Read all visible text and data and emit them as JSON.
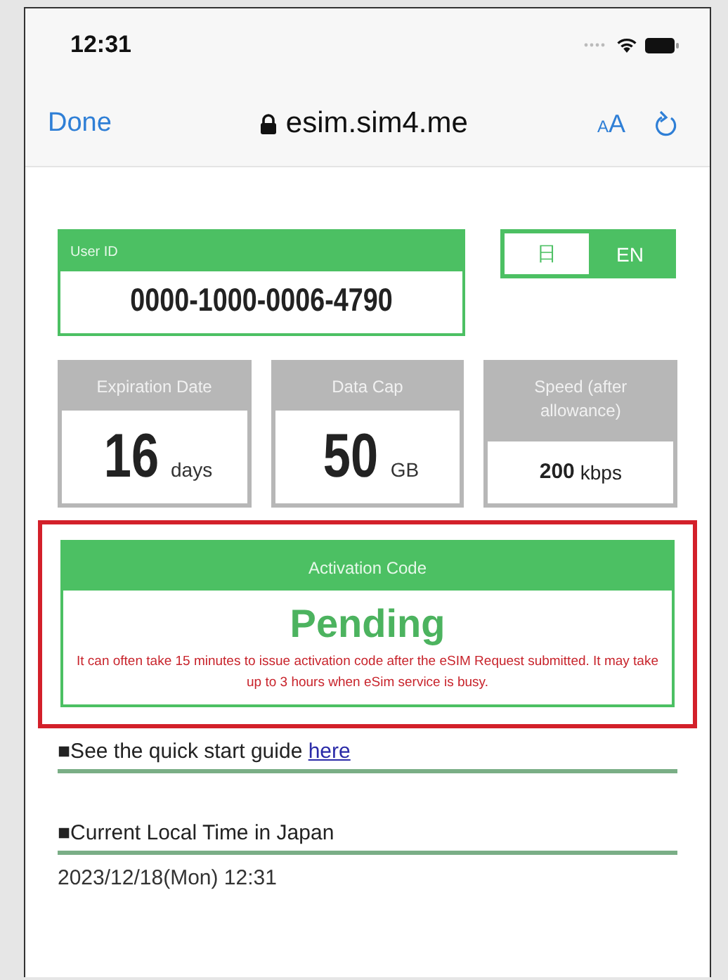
{
  "status_bar": {
    "time": "12:31"
  },
  "browser_bar": {
    "done": "Done",
    "url": "esim.sim4.me",
    "text_size": "AA"
  },
  "user_id": {
    "label": "User ID",
    "value": "0000-1000-0006-4790"
  },
  "languages": [
    {
      "label": "日",
      "selected": false
    },
    {
      "label": "EN",
      "selected": true
    }
  ],
  "stats": [
    {
      "kind": "large",
      "label": "Expiration Date",
      "value": "16",
      "unit": "days"
    },
    {
      "kind": "large",
      "label": "Data Cap",
      "value": "50",
      "unit": "GB"
    },
    {
      "kind": "small",
      "label": "Speed (after allowance)",
      "value": "200",
      "unit": "kbps"
    }
  ],
  "activation": {
    "title": "Activation Code",
    "status": "Pending",
    "note": "It can often take 15 minutes to issue activation code after the eSIM Request submitted. It may take up to 3 hours when eSim service is busy.",
    "highlighted": true
  },
  "guide": {
    "text": "■See the quick start guide",
    "link": "here"
  },
  "local_time": {
    "heading": "■Current Local Time in Japan",
    "value": "2023/12/18(Mon) 12:31"
  }
}
